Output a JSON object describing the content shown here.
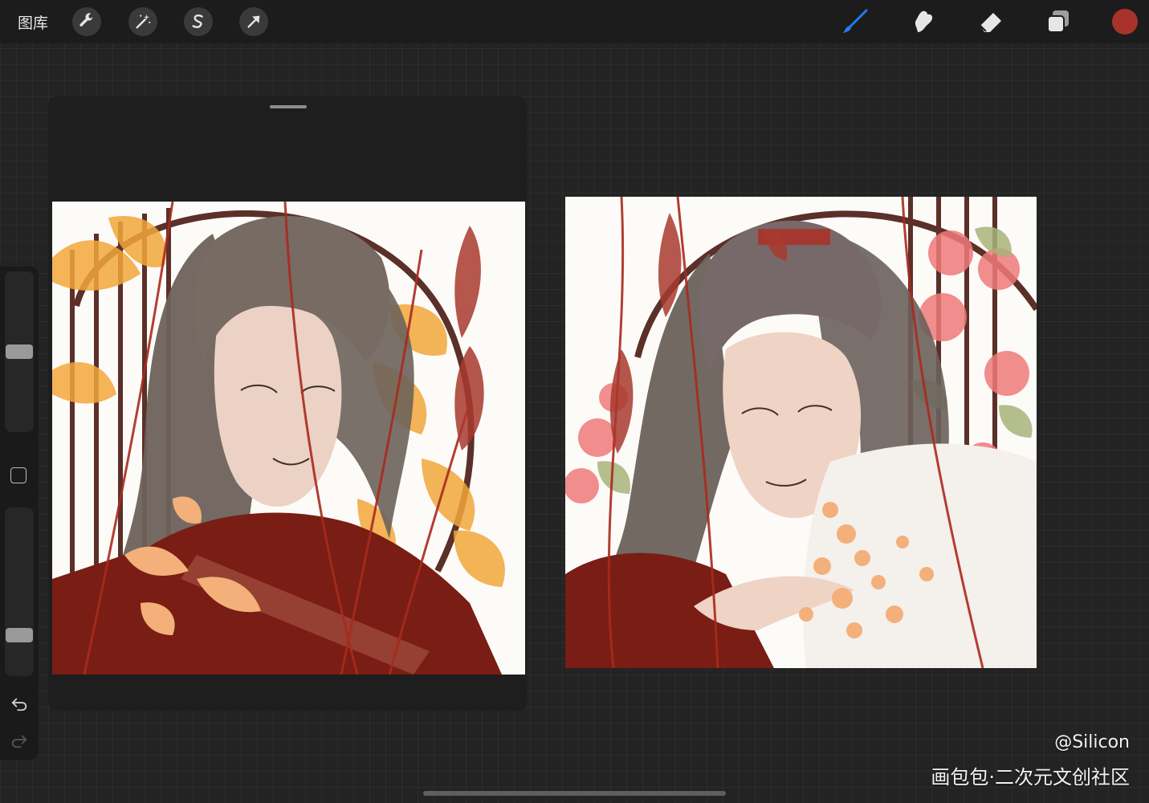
{
  "topbar": {
    "gallery_label": "图库",
    "left_tools": [
      {
        "name": "actions",
        "icon": "wrench-icon"
      },
      {
        "name": "adjustments",
        "icon": "magic-wand-icon"
      },
      {
        "name": "selection",
        "icon": "selection-s-icon"
      },
      {
        "name": "transform",
        "icon": "arrow-cursor-icon"
      }
    ],
    "right_tools": [
      {
        "name": "brush",
        "icon": "brush-icon",
        "active": true
      },
      {
        "name": "smudge",
        "icon": "smudge-icon"
      },
      {
        "name": "eraser",
        "icon": "eraser-icon"
      },
      {
        "name": "layers",
        "icon": "layers-icon"
      }
    ],
    "current_color": "#a8332a",
    "active_color": "#1e7cf0"
  },
  "sidebar": {
    "brush_size_level": 0.5,
    "opacity_level": 0.22,
    "icons": [
      "modify-square-icon",
      "undo-icon",
      "redo-icon"
    ]
  },
  "reference_window": {
    "title": ""
  },
  "canvas": {
    "artworks": [
      {
        "name": "artwork-left",
        "theme_colors": [
          "#f2a73b",
          "#7e1f16",
          "#5c5149",
          "#e8c7b7"
        ]
      },
      {
        "name": "artwork-right",
        "theme_colors": [
          "#f07a7a",
          "#7e1f16",
          "#5a524e",
          "#a8b37a"
        ]
      }
    ]
  },
  "watermark": {
    "author": "@Silicon",
    "site": "画包包·二次元文创社区"
  }
}
